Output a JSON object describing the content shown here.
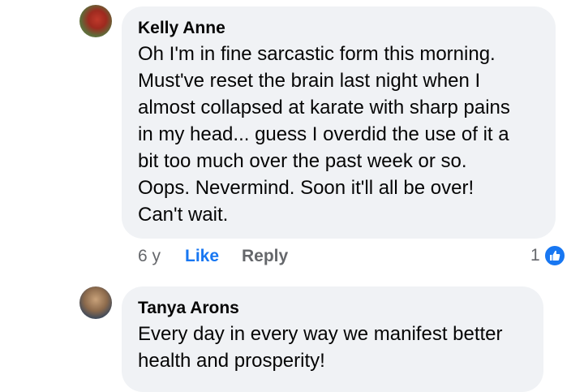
{
  "comments": [
    {
      "author": "Kelly Anne",
      "text": "Oh I'm in fine sarcastic form this morning.\nMust've reset the brain last night when I\nalmost collapsed at karate with sharp pains\nin my head... guess I overdid the use of it a\nbit too much over the past week or so.\nOops. Nevermind. Soon it'll all be over!\nCan't wait.",
      "time": "6 y",
      "like_label": "Like",
      "reply_label": "Reply",
      "reaction_count": "1",
      "reaction_icon": "thumbs-up-icon",
      "like_color": "#1877f2"
    },
    {
      "author": "Tanya Arons",
      "text": "Every day in every way we manifest better\nhealth and prosperity!"
    }
  ],
  "colors": {
    "bubble": "#f0f2f5",
    "meta": "#65676b",
    "accent": "#1877f2"
  }
}
